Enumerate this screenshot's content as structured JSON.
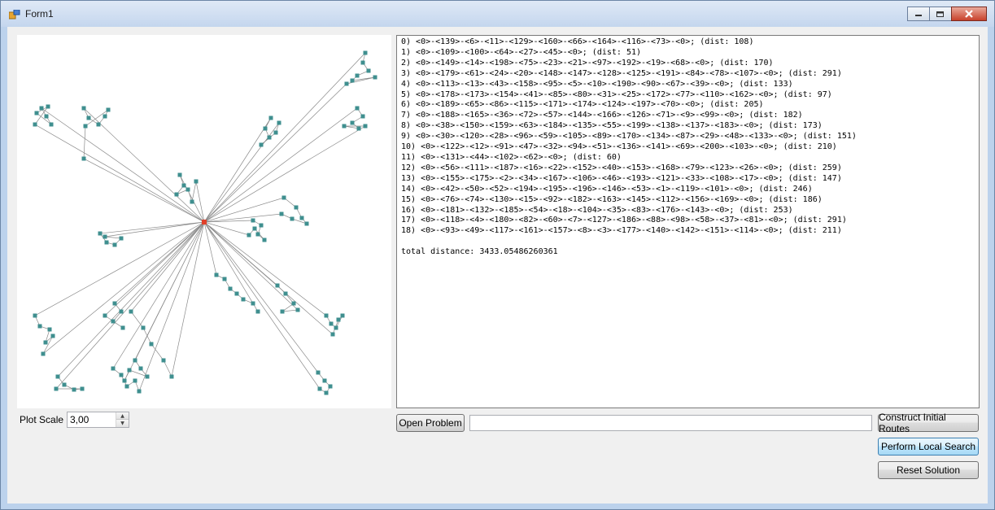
{
  "window": {
    "title": "Form1",
    "accent": "#bcd2ec"
  },
  "plot": {
    "depot_color": "#e0402a",
    "node_color": "#3f8f8f",
    "edge_color": "#8a8a8a"
  },
  "plot_scale": {
    "label": "Plot Scale",
    "value": "3,00"
  },
  "output": {
    "lines": [
      "0) <0>-<139>-<6>-<11>-<129>-<160>-<66>-<164>-<116>-<73>-<0>; (dist: 108)",
      "1) <0>-<109>-<100>-<64>-<27>-<45>-<0>; (dist: 51)",
      "2) <0>-<149>-<14>-<198>-<75>-<23>-<21>-<97>-<192>-<19>-<68>-<0>; (dist: 170)",
      "3) <0>-<179>-<61>-<24>-<20>-<148>-<147>-<128>-<125>-<191>-<84>-<78>-<107>-<0>; (dist: 291)",
      "4) <0>-<113>-<13>-<43>-<158>-<95>-<5>-<10>-<190>-<90>-<67>-<39>-<0>; (dist: 133)",
      "5) <0>-<178>-<173>-<154>-<41>-<85>-<80>-<31>-<25>-<172>-<77>-<110>-<162>-<0>; (dist: 97)",
      "6) <0>-<189>-<65>-<86>-<115>-<171>-<174>-<124>-<197>-<70>-<0>; (dist: 205)",
      "7) <0>-<188>-<165>-<36>-<72>-<57>-<144>-<166>-<126>-<71>-<9>-<99>-<0>; (dist: 182)",
      "8) <0>-<38>-<150>-<159>-<63>-<184>-<135>-<55>-<199>-<138>-<137>-<183>-<0>; (dist: 173)",
      "9) <0>-<30>-<120>-<28>-<96>-<59>-<105>-<89>-<170>-<134>-<87>-<29>-<48>-<133>-<0>; (dist: 151)",
      "10) <0>-<122>-<12>-<91>-<47>-<32>-<94>-<51>-<136>-<141>-<69>-<200>-<103>-<0>; (dist: 210)",
      "11) <0>-<131>-<44>-<102>-<62>-<0>; (dist: 60)",
      "12) <0>-<56>-<111>-<187>-<16>-<22>-<152>-<40>-<153>-<168>-<79>-<123>-<26>-<0>; (dist: 259)",
      "13) <0>-<155>-<175>-<2>-<34>-<167>-<106>-<46>-<193>-<121>-<33>-<108>-<17>-<0>; (dist: 147)",
      "14) <0>-<42>-<50>-<52>-<194>-<195>-<196>-<146>-<53>-<1>-<119>-<101>-<0>; (dist: 246)",
      "15) <0>-<76>-<74>-<130>-<15>-<92>-<182>-<163>-<145>-<112>-<156>-<169>-<0>; (dist: 186)",
      "16) <0>-<181>-<132>-<185>-<54>-<18>-<104>-<35>-<83>-<176>-<143>-<0>; (dist: 253)",
      "17) <0>-<118>-<4>-<180>-<82>-<60>-<7>-<127>-<186>-<88>-<98>-<58>-<37>-<81>-<0>; (dist: 291)",
      "18) <0>-<93>-<49>-<117>-<161>-<157>-<8>-<3>-<177>-<140>-<142>-<151>-<114>-<0>; (dist: 211)",
      "",
      "total distance: 3433.05486260361"
    ]
  },
  "buttons": {
    "open_problem": "Open Problem",
    "construct": "Construct Initial Routes",
    "local_search": "Perform Local Search",
    "reset": "Reset Solution"
  },
  "path_input": {
    "value": ""
  }
}
